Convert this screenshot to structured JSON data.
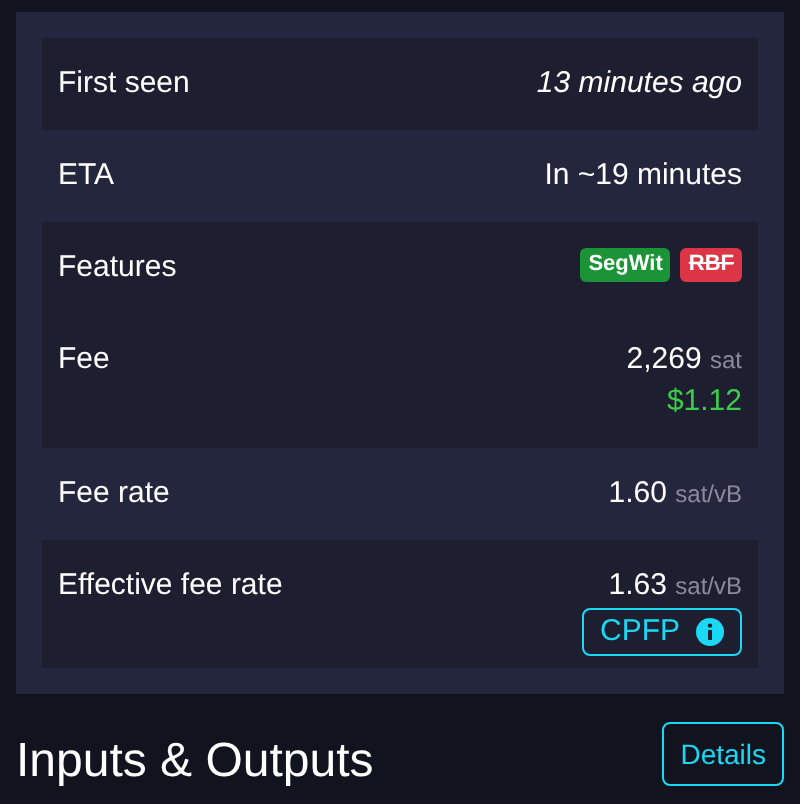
{
  "details": {
    "rows": [
      {
        "items": [
          {
            "kind": "time",
            "label": "First seen",
            "value": "13 minutes ago"
          }
        ]
      },
      {
        "items": [
          {
            "kind": "text",
            "label": "ETA",
            "value": "In ~19 minutes"
          }
        ]
      },
      {
        "items": [
          {
            "kind": "badges",
            "label": "Features",
            "badges": [
              {
                "label": "SegWit",
                "color": "#1a9436",
                "struck": false
              },
              {
                "label": "RBF",
                "color": "#dc3545",
                "struck": true
              }
            ]
          },
          {
            "kind": "amount",
            "label": "Fee",
            "value": "2,269",
            "unit": "sat",
            "fiat": "$1.12"
          }
        ]
      },
      {
        "items": [
          {
            "kind": "amount",
            "label": "Fee rate",
            "value": "1.60",
            "unit": "sat/vB"
          }
        ]
      },
      {
        "items": [
          {
            "kind": "amount",
            "label": "Effective fee rate",
            "value": "1.63",
            "unit": "sat/vB",
            "button": "CPFP"
          }
        ]
      }
    ]
  },
  "section": {
    "title": "Inputs & Outputs",
    "button": "Details"
  }
}
